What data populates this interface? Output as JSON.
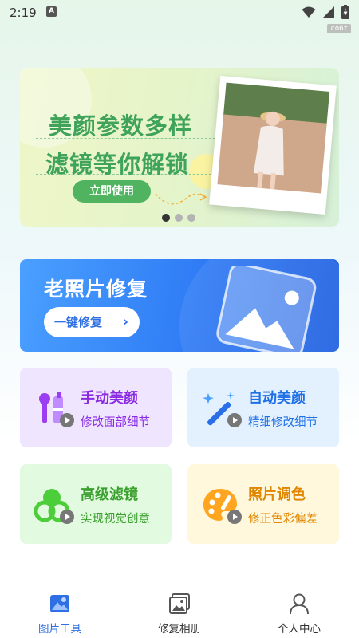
{
  "status_bar": {
    "time": "2:19",
    "notification_icon": "a-letter-icon",
    "icons": [
      "wifi-icon",
      "signal-icon",
      "battery-charging-icon"
    ],
    "watermark": "co6t"
  },
  "banner": {
    "line1": "美颜参数多样",
    "line2": "滤镜等你解锁",
    "button": "立即使用",
    "dots_count": 3,
    "active_dot": 0
  },
  "restore_card": {
    "title": "老照片修复",
    "button": "一键修复",
    "chevron": "›",
    "icon": "image-landscape-icon"
  },
  "tools": [
    {
      "title": "手动美颜",
      "subtitle": "修改面部细节",
      "icon": "makeup-brush-icon",
      "bg": "#efe5ff",
      "title_color": "#8a2be2",
      "sub_color": "#8a2be2"
    },
    {
      "title": "自动美颜",
      "subtitle": "精细修改细节",
      "icon": "magic-wand-icon",
      "bg": "#e3f1ff",
      "title_color": "#1f6fe5",
      "sub_color": "#1f6fe5"
    },
    {
      "title": "高级滤镜",
      "subtitle": "实现视觉创意",
      "icon": "filter-circles-icon",
      "bg": "#e2fbe0",
      "title_color": "#3aa12e",
      "sub_color": "#3aa12e"
    },
    {
      "title": "照片调色",
      "subtitle": "修正色彩偏差",
      "icon": "palette-icon",
      "bg": "#fff8dc",
      "title_color": "#e08600",
      "sub_color": "#e08600"
    }
  ],
  "bottom_nav": [
    {
      "label": "图片工具",
      "icon": "image-tools-icon",
      "active": true
    },
    {
      "label": "修复相册",
      "icon": "photo-album-icon",
      "active": false
    },
    {
      "label": "个人中心",
      "icon": "user-icon",
      "active": false
    }
  ],
  "colors": {
    "accent_blue": "#2f6fe4",
    "banner_green": "#3fa35a"
  }
}
